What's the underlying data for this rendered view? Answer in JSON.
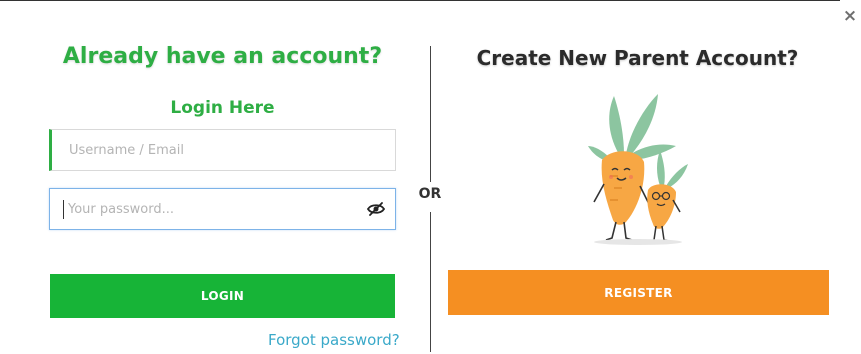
{
  "close": {
    "label": "×"
  },
  "login": {
    "title": "Already have an account?",
    "subtitle": "Login Here",
    "username_placeholder": "Username / Email",
    "password_placeholder": "Your password...",
    "button_label": "LOGIN",
    "forgot_label": "Forgot password?"
  },
  "separator": {
    "label": "OR"
  },
  "register": {
    "title": "Create New Parent Account?",
    "illustration_icon": "carrot-family-icon",
    "button_label": "REGISTER"
  },
  "colors": {
    "green": "#2eae44",
    "login_button": "#17b437",
    "register_button": "#f58f22",
    "link": "#3aa9c9"
  }
}
